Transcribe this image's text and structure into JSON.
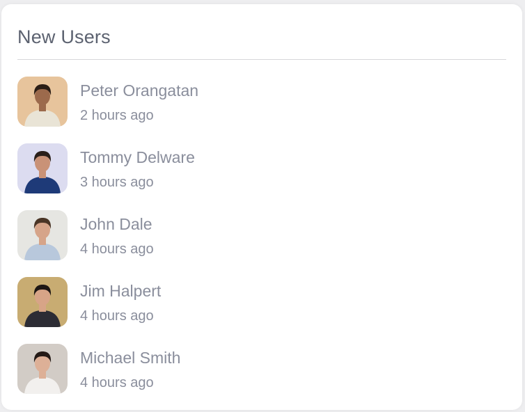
{
  "card": {
    "title": "New Users"
  },
  "users": [
    {
      "name": "Peter Orangatan",
      "time": "2 hours ago",
      "avatar_icon": "person-avatar-icon",
      "bg": "#e7c49c",
      "shirt": "#e9e4d6",
      "hair": "#2b1e16",
      "skin": "#9c6a4c"
    },
    {
      "name": "Tommy Delware",
      "time": "3 hours ago",
      "avatar_icon": "person-avatar-icon",
      "bg": "#dcdcf0",
      "shirt": "#1e3a78",
      "hair": "#2a1f1a",
      "skin": "#c99277"
    },
    {
      "name": "John Dale",
      "time": "4 hours ago",
      "avatar_icon": "person-avatar-icon",
      "bg": "#e6e6e2",
      "shirt": "#b8c8dc",
      "hair": "#4a3526",
      "skin": "#d6a489"
    },
    {
      "name": "Jim Halpert",
      "time": "4 hours ago",
      "avatar_icon": "person-avatar-icon",
      "bg": "#c8ac72",
      "shirt": "#2c2c34",
      "hair": "#1e1714",
      "skin": "#d7a487"
    },
    {
      "name": "Michael Smith",
      "time": "4 hours ago",
      "avatar_icon": "person-avatar-icon",
      "bg": "#d2ccc6",
      "shirt": "#f2f0ee",
      "hair": "#241a16",
      "skin": "#ddb097"
    }
  ]
}
